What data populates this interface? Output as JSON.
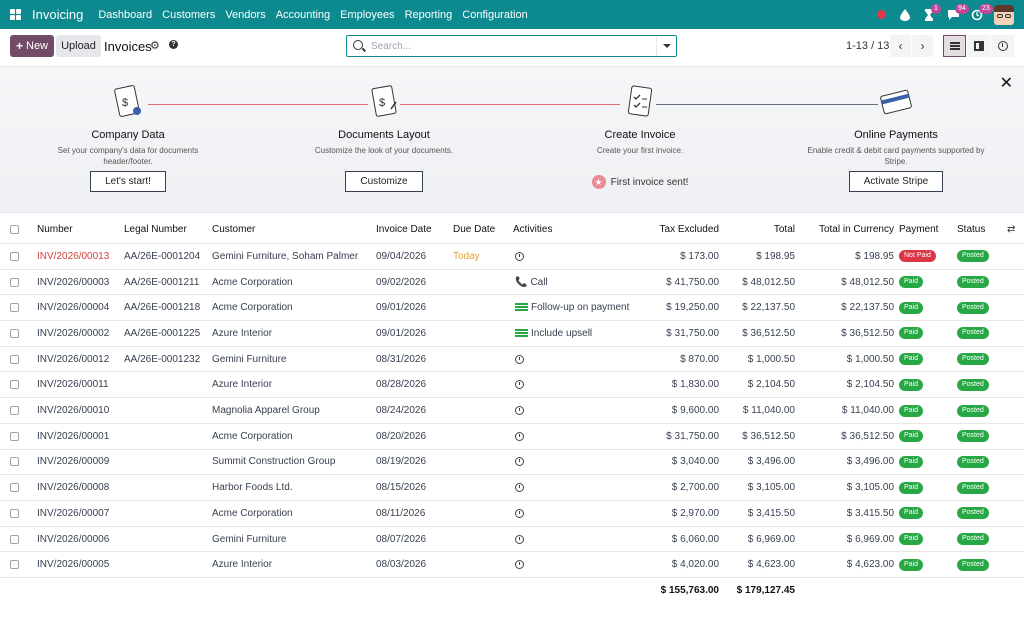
{
  "navbar": {
    "brand": "Invoicing",
    "menu": [
      "Dashboard",
      "Customers",
      "Vendors",
      "Accounting",
      "Employees",
      "Reporting",
      "Configuration"
    ],
    "badges": {
      "activities": "1",
      "messages": "94",
      "updates": "23"
    },
    "accent": "#0c8a8f"
  },
  "control": {
    "new_label": "New",
    "upload_label": "Upload",
    "title": "Invoices",
    "search_placeholder": "Search...",
    "pager": "1-13 / 13",
    "prev": "‹",
    "next": "›"
  },
  "onboarding": {
    "steps": [
      {
        "title": "Company Data",
        "desc": "Set your company's data for documents header/footer.",
        "button": "Let's start!"
      },
      {
        "title": "Documents Layout",
        "desc": "Customize the look of your documents.",
        "button": "Customize"
      },
      {
        "title": "Create Invoice",
        "desc": "Create your first invoice.",
        "done": "First invoice sent!"
      },
      {
        "title": "Online Payments",
        "desc": "Enable credit & debit card payments supported by Stripe.",
        "button": "Activate Stripe"
      }
    ]
  },
  "table": {
    "headers": [
      "Number",
      "Legal Number",
      "Customer",
      "Invoice Date",
      "Due Date",
      "Activities",
      "Tax Excluded",
      "Total",
      "Total in Currency",
      "Payment",
      "Status"
    ],
    "rows": [
      {
        "number": "INV/2026/00013",
        "legal": "AA/26E-0001204",
        "customer": "Gemini Furniture, Soham Palmer",
        "date": "09/04/2026",
        "due": "Today",
        "activity": "",
        "activity_type": "clock",
        "tax": "$ 173.00",
        "total": "$ 198.95",
        "total_cur": "$ 198.95",
        "payment": "Not Paid",
        "status": "Posted",
        "overdue": true
      },
      {
        "number": "INV/2026/00003",
        "legal": "AA/26E-0001211",
        "customer": "Acme Corporation",
        "date": "09/02/2026",
        "due": "",
        "activity": "Call",
        "activity_type": "phone",
        "tax": "$ 41,750.00",
        "total": "$ 48,012.50",
        "total_cur": "$ 48,012.50",
        "payment": "Paid",
        "status": "Posted"
      },
      {
        "number": "INV/2026/00004",
        "legal": "AA/26E-0001218",
        "customer": "Acme Corporation",
        "date": "09/01/2026",
        "due": "",
        "activity": "Follow-up on payment",
        "activity_type": "list",
        "tax": "$ 19,250.00",
        "total": "$ 22,137.50",
        "total_cur": "$ 22,137.50",
        "payment": "Paid",
        "status": "Posted"
      },
      {
        "number": "INV/2026/00002",
        "legal": "AA/26E-0001225",
        "customer": "Azure Interior",
        "date": "09/01/2026",
        "due": "",
        "activity": "Include upsell",
        "activity_type": "list",
        "tax": "$ 31,750.00",
        "total": "$ 36,512.50",
        "total_cur": "$ 36,512.50",
        "payment": "Paid",
        "status": "Posted"
      },
      {
        "number": "INV/2026/00012",
        "legal": "AA/26E-0001232",
        "customer": "Gemini Furniture",
        "date": "08/31/2026",
        "due": "",
        "activity": "",
        "activity_type": "clock",
        "tax": "$ 870.00",
        "total": "$ 1,000.50",
        "total_cur": "$ 1,000.50",
        "payment": "Paid",
        "status": "Posted"
      },
      {
        "number": "INV/2026/00011",
        "legal": "",
        "customer": "Azure Interior",
        "date": "08/28/2026",
        "due": "",
        "activity": "",
        "activity_type": "clock",
        "tax": "$ 1,830.00",
        "total": "$ 2,104.50",
        "total_cur": "$ 2,104.50",
        "payment": "Paid",
        "status": "Posted"
      },
      {
        "number": "INV/2026/00010",
        "legal": "",
        "customer": "Magnolia Apparel Group",
        "date": "08/24/2026",
        "due": "",
        "activity": "",
        "activity_type": "clock",
        "tax": "$ 9,600.00",
        "total": "$ 11,040.00",
        "total_cur": "$ 11,040.00",
        "payment": "Paid",
        "status": "Posted"
      },
      {
        "number": "INV/2026/00001",
        "legal": "",
        "customer": "Acme Corporation",
        "date": "08/20/2026",
        "due": "",
        "activity": "",
        "activity_type": "clock",
        "tax": "$ 31,750.00",
        "total": "$ 36,512.50",
        "total_cur": "$ 36,512.50",
        "payment": "Paid",
        "status": "Posted"
      },
      {
        "number": "INV/2026/00009",
        "legal": "",
        "customer": "Summit Construction Group",
        "date": "08/19/2026",
        "due": "",
        "activity": "",
        "activity_type": "clock",
        "tax": "$ 3,040.00",
        "total": "$ 3,496.00",
        "total_cur": "$ 3,496.00",
        "payment": "Paid",
        "status": "Posted"
      },
      {
        "number": "INV/2026/00008",
        "legal": "",
        "customer": "Harbor Foods Ltd.",
        "date": "08/15/2026",
        "due": "",
        "activity": "",
        "activity_type": "clock",
        "tax": "$ 2,700.00",
        "total": "$ 3,105.00",
        "total_cur": "$ 3,105.00",
        "payment": "Paid",
        "status": "Posted"
      },
      {
        "number": "INV/2026/00007",
        "legal": "",
        "customer": "Acme Corporation",
        "date": "08/11/2026",
        "due": "",
        "activity": "",
        "activity_type": "clock",
        "tax": "$ 2,970.00",
        "total": "$ 3,415.50",
        "total_cur": "$ 3,415.50",
        "payment": "Paid",
        "status": "Posted"
      },
      {
        "number": "INV/2026/00006",
        "legal": "",
        "customer": "Gemini Furniture",
        "date": "08/07/2026",
        "due": "",
        "activity": "",
        "activity_type": "clock",
        "tax": "$ 6,060.00",
        "total": "$ 6,969.00",
        "total_cur": "$ 6,969.00",
        "payment": "Paid",
        "status": "Posted"
      },
      {
        "number": "INV/2026/00005",
        "legal": "",
        "customer": "Azure Interior",
        "date": "08/03/2026",
        "due": "",
        "activity": "",
        "activity_type": "clock",
        "tax": "$ 4,020.00",
        "total": "$ 4,623.00",
        "total_cur": "$ 4,623.00",
        "payment": "Paid",
        "status": "Posted"
      }
    ],
    "totals": {
      "tax": "$ 155,763.00",
      "total": "$ 179,127.45"
    }
  }
}
